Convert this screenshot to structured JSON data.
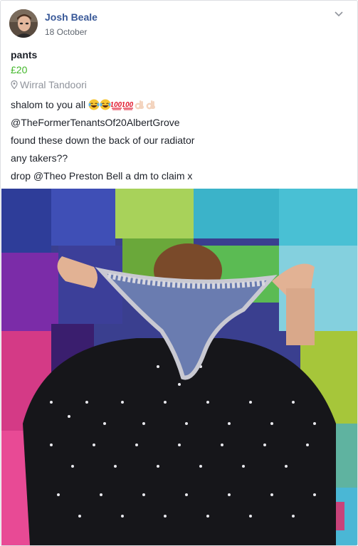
{
  "post": {
    "author": "Josh Beale",
    "date": "18 October",
    "title": "pants",
    "price": "£20",
    "location": "Wirral Tandoori",
    "lines": [
      "shalom to you all",
      "@TheFormerTenantsOf20AlbertGrove",
      "found these down the back of our radiator",
      "any takers??",
      "drop @Theo Preston Bell a dm to claim x"
    ],
    "emojis": [
      "face-with-tears-of-joy-icon",
      "face-with-tears-of-joy-icon",
      "hundred-points-icon",
      "hundred-points-icon",
      "ok-hand-icon",
      "ok-hand-icon"
    ]
  },
  "colors": {
    "author_link": "#385898",
    "price": "#42b72a",
    "secondary_text": "#606770"
  }
}
